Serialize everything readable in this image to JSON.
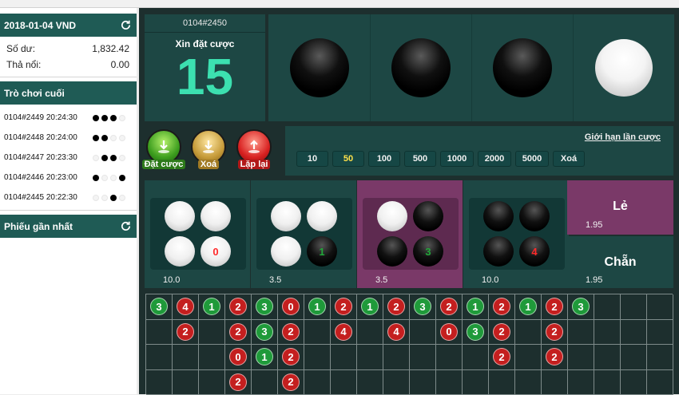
{
  "sidebar": {
    "header": {
      "title": "2018-01-04 VND"
    },
    "balance_label": "Số dư:",
    "balance_value": "1,832.42",
    "float_label": "Thả nổi:",
    "float_value": "0.00",
    "recent_title": "Trò chơi cuối",
    "history": [
      {
        "label": "0104#2449 20:24:30",
        "dots": [
          "b",
          "b",
          "b",
          "w"
        ]
      },
      {
        "label": "0104#2448 20:24:00",
        "dots": [
          "b",
          "b",
          "w",
          "w"
        ]
      },
      {
        "label": "0104#2447 20:23:30",
        "dots": [
          "w",
          "b",
          "b",
          "w"
        ]
      },
      {
        "label": "0104#2446 20:23:00",
        "dots": [
          "b",
          "w",
          "w",
          "b"
        ]
      },
      {
        "label": "0104#2445 20:22:30",
        "dots": [
          "w",
          "w",
          "b",
          "w"
        ]
      }
    ],
    "tickets_title": "Phiếu gần nhất"
  },
  "game": {
    "session": "0104#2450",
    "prompt": "Xin đặt cược",
    "countdown": "15",
    "result_discs": [
      "black",
      "black",
      "black",
      "white"
    ]
  },
  "actions": {
    "place_bet": "Đặt cược",
    "clear": "Xoá",
    "repeat": "Lặp lại"
  },
  "limits": {
    "title": "Giới hạn lần cược",
    "chips": [
      "10",
      "50",
      "100",
      "500",
      "1000",
      "2000",
      "5000",
      "Xoá"
    ],
    "selected_chip": "50"
  },
  "bets": [
    {
      "odds": "10.0",
      "balls": [
        "white",
        "white",
        "white",
        "white"
      ],
      "count": "0",
      "count_color": "red"
    },
    {
      "odds": "3.5",
      "balls": [
        "white",
        "white",
        "white",
        "black"
      ],
      "count": "1",
      "count_color": "green"
    },
    {
      "odds": "3.5",
      "balls": [
        "white",
        "black",
        "black",
        "black"
      ],
      "count": "3",
      "count_color": "green"
    },
    {
      "odds": "10.0",
      "balls": [
        "black",
        "black",
        "black",
        "black"
      ],
      "count": "4",
      "count_color": "red"
    }
  ],
  "side_bets": {
    "odd": {
      "label": "Lẻ",
      "odds": "1.95"
    },
    "even": {
      "label": "Chẵn",
      "odds": "1.95"
    }
  },
  "road": [
    [
      {
        "v": "3",
        "c": "green"
      },
      {
        "v": "4",
        "c": "red"
      },
      {
        "v": "1",
        "c": "green"
      },
      {
        "v": "2",
        "c": "red"
      },
      {
        "v": "3",
        "c": "green"
      },
      {
        "v": "0",
        "c": "red"
      },
      {
        "v": "1",
        "c": "green"
      },
      {
        "v": "2",
        "c": "red"
      },
      {
        "v": "1",
        "c": "green"
      },
      {
        "v": "2",
        "c": "red"
      },
      {
        "v": "3",
        "c": "green"
      },
      {
        "v": "2",
        "c": "red"
      },
      {
        "v": "1",
        "c": "green"
      },
      {
        "v": "2",
        "c": "red"
      },
      {
        "v": "1",
        "c": "green"
      },
      {
        "v": "2",
        "c": "red"
      },
      {
        "v": "3",
        "c": "green"
      },
      null,
      null,
      null
    ],
    [
      null,
      {
        "v": "2",
        "c": "red"
      },
      null,
      {
        "v": "2",
        "c": "red"
      },
      {
        "v": "3",
        "c": "green"
      },
      {
        "v": "2",
        "c": "red"
      },
      null,
      {
        "v": "4",
        "c": "red"
      },
      null,
      {
        "v": "4",
        "c": "red"
      },
      null,
      {
        "v": "0",
        "c": "red"
      },
      {
        "v": "3",
        "c": "green"
      },
      {
        "v": "2",
        "c": "red"
      },
      null,
      {
        "v": "2",
        "c": "red"
      },
      null,
      null,
      null,
      null
    ],
    [
      null,
      null,
      null,
      {
        "v": "0",
        "c": "red"
      },
      {
        "v": "1",
        "c": "green"
      },
      {
        "v": "2",
        "c": "red"
      },
      null,
      null,
      null,
      null,
      null,
      null,
      null,
      {
        "v": "2",
        "c": "red"
      },
      null,
      {
        "v": "2",
        "c": "red"
      },
      null,
      null,
      null,
      null
    ],
    [
      null,
      null,
      null,
      {
        "v": "2",
        "c": "red"
      },
      null,
      {
        "v": "2",
        "c": "red"
      },
      null,
      null,
      null,
      null,
      null,
      null,
      null,
      null,
      null,
      null,
      null,
      null,
      null,
      null
    ]
  ]
}
